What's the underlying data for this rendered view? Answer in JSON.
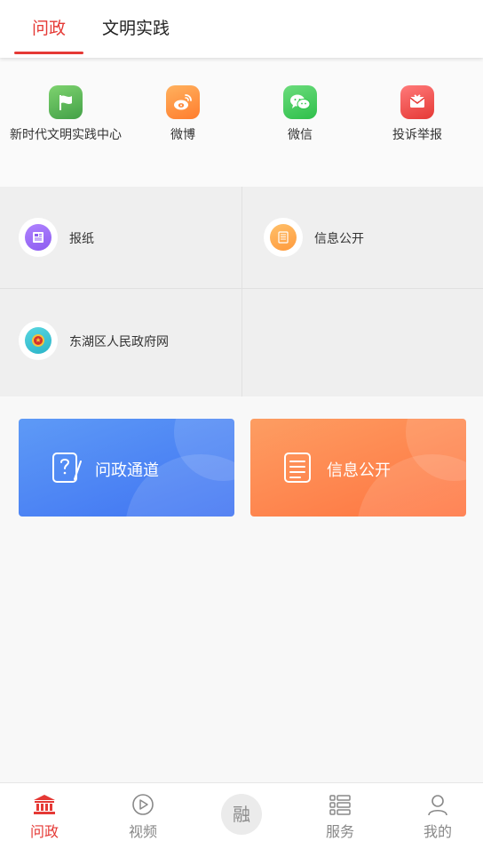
{
  "tabs": [
    {
      "label": "问政",
      "active": true
    },
    {
      "label": "文明实践",
      "active": false
    }
  ],
  "quick_links": [
    {
      "label": "新时代文明实践中心",
      "icon": "flag-icon",
      "color": "#4caf50"
    },
    {
      "label": "微博",
      "icon": "weibo-icon",
      "color": "#ff8a3d"
    },
    {
      "label": "微信",
      "icon": "wechat-icon",
      "color": "#33c84c"
    },
    {
      "label": "投诉举报",
      "icon": "envelope-icon",
      "color": "#ef4444"
    }
  ],
  "grid_items": [
    {
      "label": "报纸",
      "icon": "newspaper-icon",
      "color": "#8c5cf0"
    },
    {
      "label": "信息公开",
      "icon": "document-icon",
      "color": "#ff9a3c"
    },
    {
      "label": "东湖区人民政府网",
      "icon": "national-emblem-icon",
      "color": "#2bb4c8"
    }
  ],
  "cards": [
    {
      "label": "问政通道",
      "icon": "question-note-icon",
      "color": "#4a80f5"
    },
    {
      "label": "信息公开",
      "icon": "list-document-icon",
      "color": "#ff8350"
    }
  ],
  "bottom_nav": [
    {
      "label": "问政",
      "icon": "government-building-icon",
      "active": true
    },
    {
      "label": "视频",
      "icon": "play-circle-icon",
      "active": false
    },
    {
      "label": "融",
      "icon": "rong-center-icon",
      "active": false
    },
    {
      "label": "服务",
      "icon": "services-list-icon",
      "active": false
    },
    {
      "label": "我的",
      "icon": "user-icon",
      "active": false
    }
  ],
  "colors": {
    "accent": "#e53935",
    "background": "#f8f8f8"
  }
}
